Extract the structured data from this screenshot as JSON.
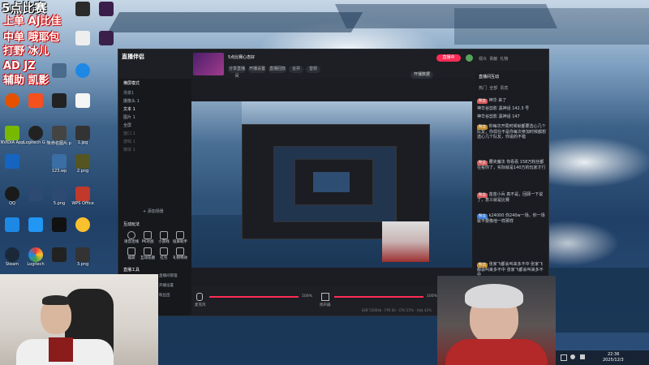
{
  "overlay": {
    "line1": "5点比赛",
    "line2": "上单 AJ比佳",
    "line3": "中单 哦耶包",
    "line4": "打野 冰儿",
    "line5": "AD JZ",
    "line6": "辅助 凯影"
  },
  "desktop": {
    "icons": [
      {
        "label": "NVIDIA App",
        "color": "#76b900"
      },
      {
        "label": "Logitech G HUB",
        "color": "#222"
      },
      {
        "label": "未命名图片.png",
        "color": "#444"
      },
      {
        "label": "1.jpg",
        "color": "#333"
      },
      {
        "label": "123.wp",
        "color": "#3b6ea5"
      },
      {
        "label": "2.png",
        "color": "#552"
      },
      {
        "label": "QQ",
        "color": "#1a1a1a"
      },
      {
        "label": "5.png",
        "color": "#2d4a74"
      },
      {
        "label": "WPS Office",
        "color": "#c0392b"
      },
      {
        "label": "Steam",
        "color": "#1b2838"
      },
      {
        "label": "Logitech",
        "color": "#111"
      },
      {
        "label": "3.png",
        "color": "#333"
      }
    ]
  },
  "app": {
    "logo": "直播伴侣",
    "mode": "横屏模式",
    "scene_title": "场景1",
    "sources_header": "添加素材",
    "sources": [
      "摄像头 1",
      "文本 1",
      "图片 1",
      "全屏",
      "窗口 1",
      "游戏 1",
      "媒体 1"
    ],
    "add_scene": "+ 添加场景",
    "tools_header": "互动玩法",
    "tools": [
      "语音连线",
      "PK对战",
      "小游戏",
      "投屏助手",
      "福袋",
      "互动答题",
      "红包",
      "礼物特效"
    ],
    "quick_header": "直播工具",
    "quick": [
      "直播间管理",
      "开播设置",
      "粉丝团"
    ],
    "live_title": "5点比赛心态好",
    "top_actions": [
      "分享直播间",
      "开播设置",
      "直播回放",
      "合并",
      "音效"
    ],
    "live_badge": "开播数据",
    "status_live": "直播中",
    "footer": {
      "mic_label": "麦克风",
      "mic_value": "100%",
      "spk_label": "扬声器",
      "spk_value": "100%",
      "stats": [
        "码率 5300kb",
        "FPS 60",
        "CPU 25%",
        "内存 42%"
      ]
    },
    "right": {
      "tabs": [
        "观众",
        "贡献",
        "礼物"
      ],
      "header": "直播间互动",
      "subtabs": [
        "热门",
        "全部",
        "贵宾"
      ],
      "messages": [
        {
          "badge": "粉丝",
          "badge_color": "#d35b5b",
          "user": "神华",
          "text": "来了"
        },
        {
          "badge": "",
          "badge_color": "#888",
          "user": "神华谷剪影",
          "text": "黑神话 142.3 号"
        },
        {
          "badge": "",
          "badge_color": "#888",
          "user": "神华谷剪影",
          "text": "黑神话 147"
        },
        {
          "badge": "粉丝",
          "badge_color": "#c08b2e",
          "user": "",
          "text": "你每次开局时候就都要选心几个队友，你现在不是你每次参加时候都想选心几个队友，你说的不错"
        },
        {
          "badge": "粉丝",
          "badge_color": "#d35b5b",
          "user": "腰夹魔法",
          "text": "你看看 158万粉丝都在看你了，实际就是140万的玩家才行"
        },
        {
          "badge": "粉丝",
          "badge_color": "#d35b5b",
          "user": "苗苗小兵",
          "text": "真不是，回顾一下说了，意义就是比赛"
        },
        {
          "badge": "粉丝",
          "badge_color": "#3a7bd5",
          "user": "k24000",
          "text": "你240w一场，你一场就不要像他一样那样"
        },
        {
          "badge": "粉丝",
          "badge_color": "#c08b2e",
          "user": "",
          "text": "张家飞都会叫来多不中 张家飞都会叫来多不中 张家飞都会叫来多不中"
        }
      ]
    }
  },
  "taskbar": {
    "time": "22:36",
    "date": "2025/12/3"
  }
}
